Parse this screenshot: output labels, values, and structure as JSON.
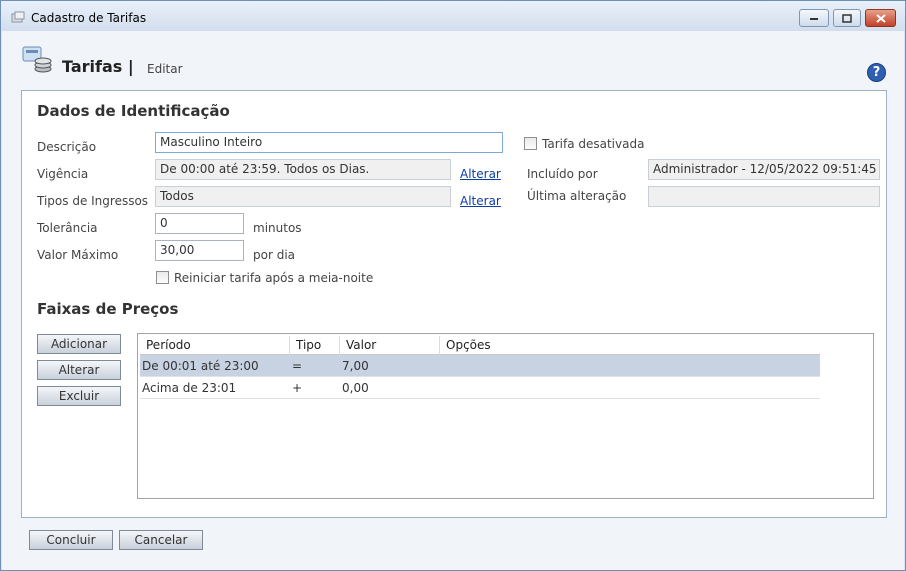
{
  "window": {
    "title": "Cadastro de Tarifas"
  },
  "header": {
    "title": "Tarifas |",
    "subtitle": "Editar",
    "help": "?"
  },
  "identificacao": {
    "section_title": "Dados de Identificação",
    "descricao_label": "Descrição",
    "descricao_value": "Masculino Inteiro",
    "vigencia_label": "Vigência",
    "vigencia_value": "De 00:00 até 23:59. Todos os Dias.",
    "vigencia_link": "Alterar",
    "tipos_label": "Tipos de Ingressos",
    "tipos_value": "Todos",
    "tipos_link": "Alterar",
    "tolerancia_label": "Tolerância",
    "tolerancia_value": "0",
    "tolerancia_unit": "minutos",
    "valor_max_label": "Valor Máximo",
    "valor_max_value": "30,00",
    "valor_max_unit": "por dia",
    "reiniciar_label": "Reiniciar tarifa após a meia-noite",
    "desativada_label": "Tarifa desativada",
    "incluido_label": "Incluído por",
    "incluido_value": "Administrador - 12/05/2022 09:51:45",
    "ultima_label": "Última alteração",
    "ultima_value": ""
  },
  "faixas": {
    "section_title": "Faixas de Preços",
    "buttons": {
      "adicionar": "Adicionar",
      "alterar": "Alterar",
      "excluir": "Excluir"
    },
    "columns": [
      "Período",
      "Tipo",
      "Valor",
      "Opções"
    ],
    "rows": [
      {
        "periodo": "De 00:01 até 23:00",
        "tipo": "=",
        "valor": "7,00",
        "opcoes": "",
        "selected": true
      },
      {
        "periodo": "Acima de 23:01",
        "tipo": "+",
        "valor": "0,00",
        "opcoes": "",
        "selected": false
      }
    ]
  },
  "footer": {
    "concluir": "Concluir",
    "cancelar": "Cancelar"
  },
  "colors": {
    "accent": "#2e5fb0",
    "selection": "#c7d3e3",
    "link": "#0b3ea8"
  }
}
